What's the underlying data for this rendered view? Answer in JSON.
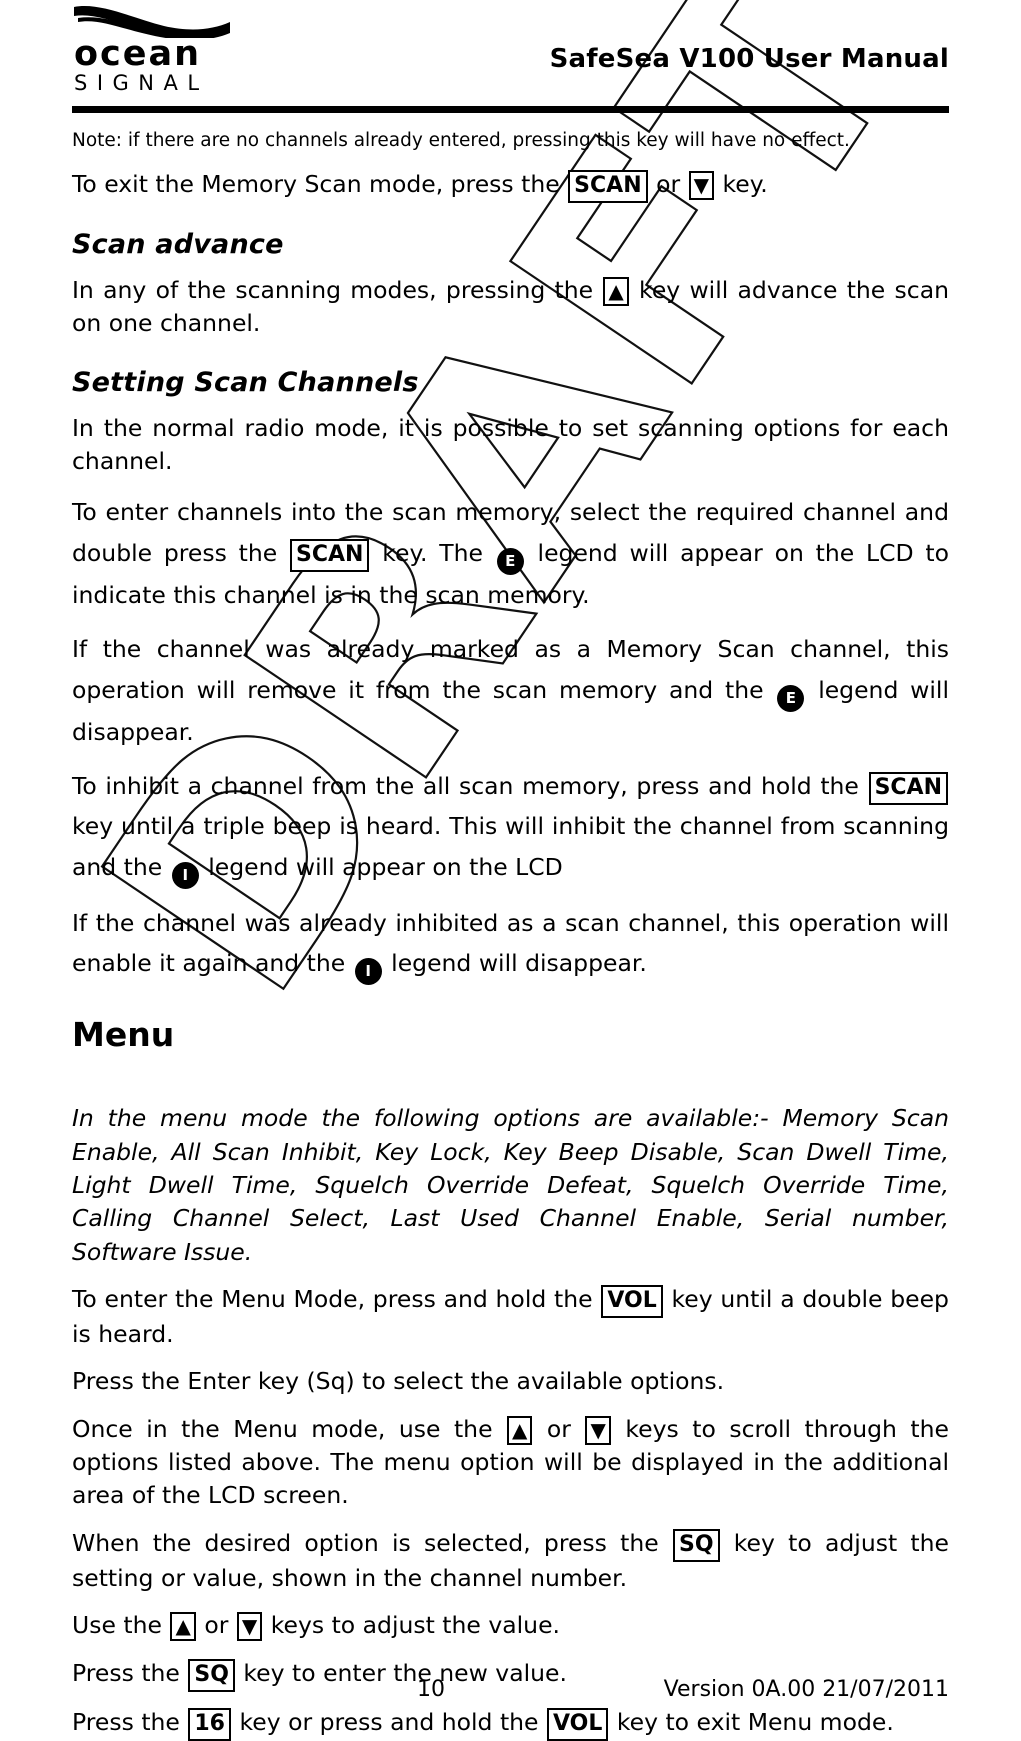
{
  "header": {
    "logo_brand": "ocean",
    "logo_sub": "SIGNAL",
    "logo_icon": "wave-swoosh",
    "doc_title": "SafeSea V100 User Manual"
  },
  "watermark": {
    "text": "DRAFT"
  },
  "body": {
    "note": "Note: if there are no channels already entered, pressing this key will have no effect.",
    "exit_memory_scan": {
      "part1": "To exit the Memory Scan mode, press the",
      "key1": "SCAN",
      "part2": "or",
      "key2": "▼",
      "part3": "key."
    },
    "scan_advance": {
      "heading": "Scan advance",
      "part1": "In any of the scanning modes, pressing the",
      "key1": "▲",
      "part2": "key will advance the scan on one channel."
    },
    "setting_scan_channels": {
      "heading": "Setting Scan Channels",
      "p1": "In the normal radio mode, it is possible to set scanning options for each channel.",
      "p2_part1": "To enter channels into the scan memory, select the required channel and double press the",
      "p2_key": "SCAN",
      "p2_part2": "key.  The",
      "p2_badge": "E",
      "p2_part3": "legend will appear on the LCD to indicate this channel is in the scan memory.",
      "p3_part1": "If the channel was already marked as a Memory Scan channel, this operation will remove it from the scan memory and the",
      "p3_badge": "E",
      "p3_part2": "legend will disappear.",
      "p4_part1": "To inhibit a channel from the all scan memory, press and hold the",
      "p4_key": "SCAN",
      "p4_part2": "key until a triple beep is heard. This will inhibit the channel from scanning and the",
      "p4_badge": "I",
      "p4_part3": "legend will appear on the LCD",
      "p5_part1": "If the channel was already inhibited as a scan channel, this operation will enable it again and the",
      "p5_badge": "I",
      "p5_part2": "legend will disappear."
    },
    "menu": {
      "heading": "Menu",
      "options_intro": "In the menu mode the following options are available:- Memory Scan Enable, All Scan Inhibit, Key Lock, Key Beep Disable, Scan Dwell Time, Light Dwell Time, Squelch Override Defeat, Squelch Override Time, Calling Channel Select, Last Used Channel Enable, Serial number, Software Issue.",
      "enter_part1": "To enter the Menu Mode, press and hold the",
      "enter_key": "VOL",
      "enter_part2": "key until a double beep is heard.",
      "enter_select": "Press the Enter key (Sq) to select the available options.",
      "scroll_part1": "Once in the Menu mode, use the",
      "scroll_key1": "▲",
      "scroll_part2": "or",
      "scroll_key2": "▼",
      "scroll_part3": "keys to scroll through the options listed above.  The menu option will be displayed in the additional area of the LCD screen.",
      "adjust_part1": "When the desired option is selected, press the",
      "adjust_key": "SQ",
      "adjust_part2": "key to adjust the setting or value, shown in the channel number.",
      "use_part1": "Use the",
      "use_key1": "▲",
      "use_part2": "or",
      "use_key2": "▼",
      "use_part3": "keys to adjust the value.",
      "press_sq_part1": "Press the",
      "press_sq_key": "SQ",
      "press_sq_part2": "key to enter the new value.",
      "exit_part1": "Press the",
      "exit_key1": "16",
      "exit_part2": "key or press and hold the",
      "exit_key2": "VOL",
      "exit_part3": "key to exit Menu mode."
    }
  },
  "footer": {
    "page_number": "10",
    "version": "Version 0A.00 21/07/2011"
  }
}
